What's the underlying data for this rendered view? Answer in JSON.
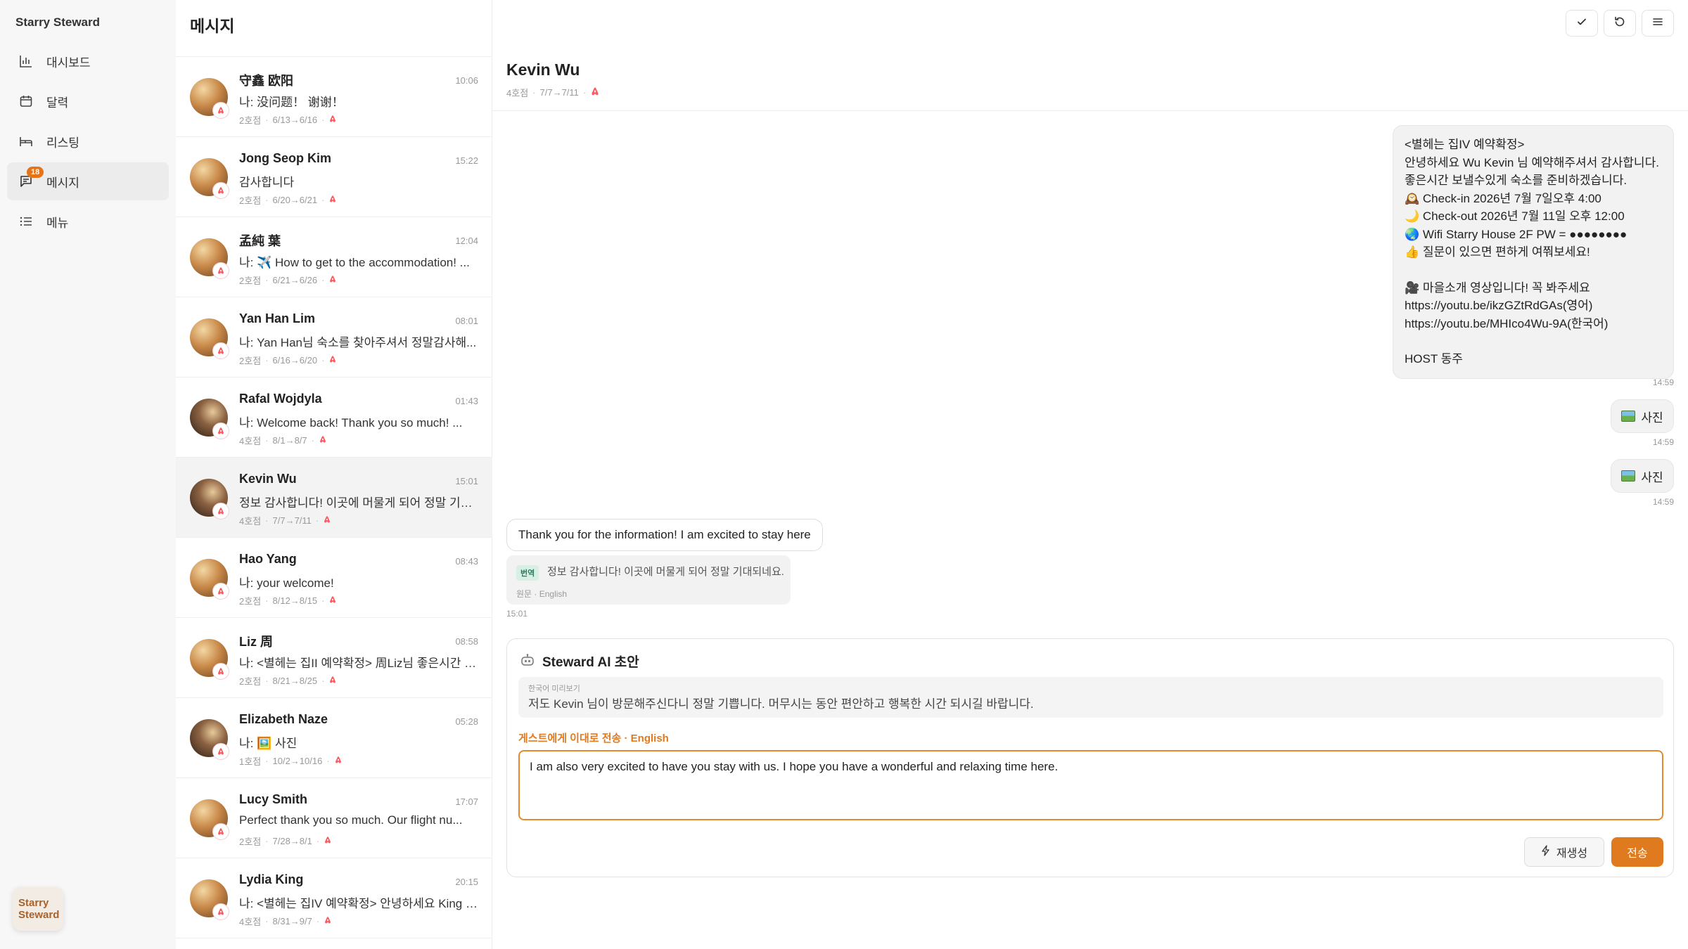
{
  "sidebar": {
    "brand": "Starry Steward",
    "items": [
      {
        "label": "대시보드",
        "icon": "bar-chart-icon"
      },
      {
        "label": "달력",
        "icon": "calendar-icon"
      },
      {
        "label": "리스팅",
        "icon": "bed-icon"
      },
      {
        "label": "메시지",
        "icon": "message-icon",
        "badge": "18"
      },
      {
        "label": "메뉴",
        "icon": "list-icon"
      }
    ],
    "logo_line1": "Starry",
    "logo_line2": "Steward"
  },
  "list": {
    "title": "메시지",
    "conversations": [
      {
        "name": "守鑫 欧阳",
        "time": "10:06",
        "preview": "나: 没问题！ 谢谢！",
        "room": "2호점",
        "dates": "6/13→6/16"
      },
      {
        "name": "Jong Seop Kim",
        "time": "15:22",
        "preview": "감사합니다",
        "room": "2호점",
        "dates": "6/20→6/21"
      },
      {
        "name": "孟純 葉",
        "time": "12:04",
        "preview": "나: ✈️ How to get to the accommodation! ...",
        "room": "2호점",
        "dates": "6/21→6/26"
      },
      {
        "name": "Yan Han Lim",
        "time": "08:01",
        "preview": "나: Yan Han님 숙소를 찾아주셔서 정말감사해...",
        "room": "2호점",
        "dates": "6/16→6/20"
      },
      {
        "name": "Rafal Wojdyla",
        "time": "01:43",
        "preview": "나: Welcome back! Thank you so much! ...",
        "room": "4호점",
        "dates": "8/1→8/7"
      },
      {
        "name": "Kevin Wu",
        "time": "15:01",
        "preview": "정보 감사합니다! 이곳에 머물게 되어 정말 기대...",
        "room": "4호점",
        "dates": "7/7→7/11"
      },
      {
        "name": "Hao Yang",
        "time": "08:43",
        "preview": "나: your welcome!",
        "room": "2호점",
        "dates": "8/12→8/15"
      },
      {
        "name": "Liz 周",
        "time": "08:58",
        "preview": "나: <별헤는 집II 예약확정> 周Liz님 좋은시간 보...",
        "room": "2호점",
        "dates": "8/21→8/25"
      },
      {
        "name": "Elizabeth Naze",
        "time": "05:28",
        "preview": "나: 🖼️ 사진",
        "room": "1호점",
        "dates": "10/2→10/16"
      },
      {
        "name": "Lucy Smith",
        "time": "17:07",
        "preview": "Perfect thank you so much. Our flight nu...",
        "room": "2호점",
        "dates": "7/28→8/1"
      },
      {
        "name": "Lydia King",
        "time": "20:15",
        "preview": "나: <별헤는 집IV 예약확정> 안녕하세요 King L...",
        "room": "4호점",
        "dates": "8/31→9/7"
      }
    ]
  },
  "chat": {
    "name": "Kevin Wu",
    "room": "4호점",
    "dates": "7/7→7/11",
    "host_message_lines": [
      "<별헤는 집IV 예약확정>",
      "안녕하세요 Wu Kevin 님 예약해주셔서 감사합니다.",
      "좋은시간 보낼수있게 숙소를 준비하겠습니다.",
      "🕰️ Check-in 2026년 7월 7일오후 4:00",
      "🌙 Check-out 2026년 7월 11일 오후 12:00",
      "🌏 Wifi Starry House 2F PW = ●●●●●●●●",
      "👍 질문이 있으면 편하게 여쭤보세요!",
      "",
      "🎥 마을소개 영상입니다! 꼭 봐주세요",
      "https://youtu.be/ikzGZtRdGAs(영어)",
      "https://youtu.be/MHIco4Wu-9A(한국어)",
      "",
      "HOST 동주"
    ],
    "host_message_time": "14:59",
    "photo_label": "사진",
    "photo1_time": "14:59",
    "photo2_time": "14:59",
    "guest_message": "Thank you for the information! I am excited to stay here",
    "translation_tag": "번역",
    "translation_text": "정보 감사합니다! 이곳에 머물게 되어 정말 기대되네요.",
    "translation_meta": "원문 · English",
    "guest_time": "15:01"
  },
  "ai_draft": {
    "title": "Steward AI 초안",
    "preview_label": "한국어 미리보기",
    "preview_text": "저도 Kevin 님이 방문해주신다니 정말 기쁩니다. 머무시는 동안 편안하고 행복한 시간 되시길 바랍니다.",
    "send_label": "게스트에게 이대로 전송 · English",
    "reply_value": "I am also very excited to have you stay with us. I hope you have a wonderful and relaxing time here.",
    "regenerate_label": "재생성",
    "send_button_label": "전송"
  },
  "colors": {
    "accent": "#e07a1f",
    "airbnb": "#ff5a5f",
    "translate_tag_bg": "#d8efe6"
  }
}
